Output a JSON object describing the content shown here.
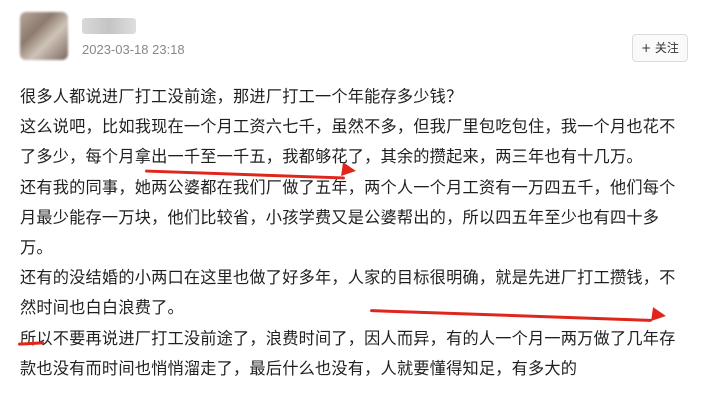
{
  "post": {
    "author_name": "",
    "timestamp": "2023-03-18 23:18",
    "follow_label": "+ 关注",
    "paragraphs": [
      "很多人都说进厂打工没前途，那进厂打工一个年能存多少钱？",
      "这么说吧，比如我现在一个月工资六七千，虽然不多，但我厂里包吃包住，我一个月也花不了多少，每个月拿出一千至一千五，我都够花了，其余的攒起来，两三年也有十几万。",
      "还有我的同事，她两公婆都在我们厂做了五年，两个人一个月工资有一万四五千，他们每个月最少能存一万块，他们比较省，小孩学费又是公婆帮出的，所以四五年至少也有四十多万。",
      "还有的没结婚的小两口在这里也做了好多年，人家的目标很明确，就是先进厂打工攒钱，不然时间也白白浪费了。",
      "所以不要再说进厂打工没前途了，浪费时间了，因人而异，有的人一个月一两万做了几年存款也没有而时间也悄悄溜走了，最后什么也没有，人就要懂得知足，有多大的"
    ]
  },
  "annotation_color": "#e0261c"
}
